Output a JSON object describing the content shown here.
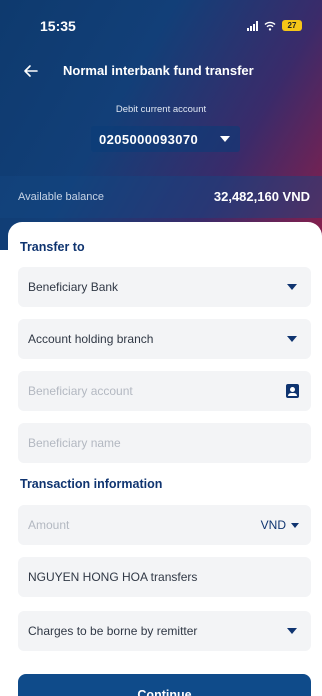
{
  "status_bar": {
    "time": "15:35",
    "battery": "27"
  },
  "header": {
    "title": "Normal interbank fund transfer"
  },
  "debit": {
    "label": "Debit current account",
    "account": "0205000093070"
  },
  "balance": {
    "label": "Available balance",
    "value": "32,482,160 VND"
  },
  "transfer_to": {
    "title": "Transfer to",
    "bank": "Beneficiary Bank",
    "branch": "Account holding branch",
    "account_placeholder": "Beneficiary account",
    "name_placeholder": "Beneficiary name"
  },
  "transaction": {
    "title": "Transaction information",
    "amount_placeholder": "Amount",
    "currency": "VND",
    "description": "NGUYEN HONG HOA transfers",
    "charges": "Charges to be borne by remitter"
  },
  "actions": {
    "continue": "Continue"
  }
}
